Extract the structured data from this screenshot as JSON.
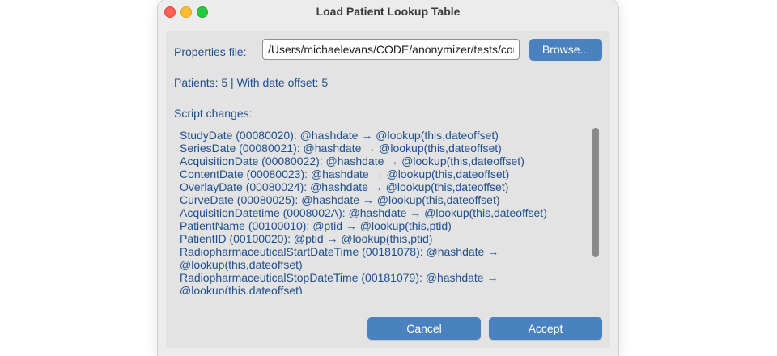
{
  "window": {
    "title": "Load Patient Lookup Table"
  },
  "form": {
    "properties_label": "Properties file:",
    "properties_value": "/Users/michaelevans/CODE/anonymizer/tests/controller/assets/patient_lookup.properties",
    "browse_label": "Browse...",
    "stats": "Patients: 5  |  With date offset: 5",
    "changes_label": "Script changes:",
    "changes": [
      "StudyDate (00080020): @hashdate → @lookup(this,dateoffset)",
      "SeriesDate (00080021): @hashdate → @lookup(this,dateoffset)",
      "AcquisitionDate (00080022): @hashdate → @lookup(this,dateoffset)",
      "ContentDate (00080023): @hashdate → @lookup(this,dateoffset)",
      "OverlayDate (00080024): @hashdate → @lookup(this,dateoffset)",
      "CurveDate (00080025): @hashdate → @lookup(this,dateoffset)",
      "AcquisitionDatetime (0008002A): @hashdate → @lookup(this,dateoffset)",
      "PatientName (00100010): @ptid → @lookup(this,ptid)",
      "PatientID (00100020): @ptid → @lookup(this,ptid)",
      "RadiopharmaceuticalStartDateTime (00181078): @hashdate →",
      "@lookup(this,dateoffset)",
      "RadiopharmaceuticalStopDateTime (00181079): @hashdate →",
      "@lookup(this,dateoffset)"
    ]
  },
  "actions": {
    "cancel_label": "Cancel",
    "accept_label": "Accept"
  },
  "colors": {
    "accent": "#4a82c0",
    "label_text": "#1f4e8c"
  }
}
